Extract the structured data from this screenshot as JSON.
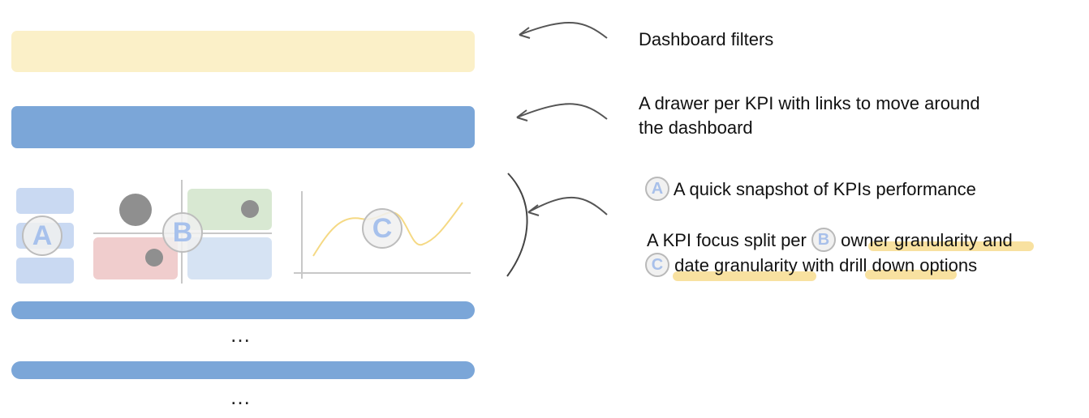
{
  "annotations": {
    "filters": "Dashboard filters",
    "drawer_line1": "A drawer per KPI with links to move around",
    "drawer_line2": "the dashboard",
    "snapshot": "A quick snapshot of KPIs performance",
    "focus_line1_pre": "A KPI focus split per",
    "focus_line1_post": "owner granularity and",
    "focus_line2_a": "date granularity with",
    "focus_line2_b": "drill down",
    "focus_line2_c": "options"
  },
  "badges": {
    "a": "A",
    "b": "B",
    "c": "C"
  },
  "ellipsis": "…",
  "colors": {
    "filters_bar": "#fbf0c8",
    "drawer_bar": "#7ba6d8",
    "snapshot_blocks": "#c9d9f2",
    "green_block": "#d8e8d2",
    "red_block": "#f0cdcd",
    "blue_block": "#d6e3f3",
    "dot": "#8f8f8f",
    "line": "#f5d984",
    "highlight": "#f7dc8f",
    "badge_text": "#a8c0ea"
  }
}
